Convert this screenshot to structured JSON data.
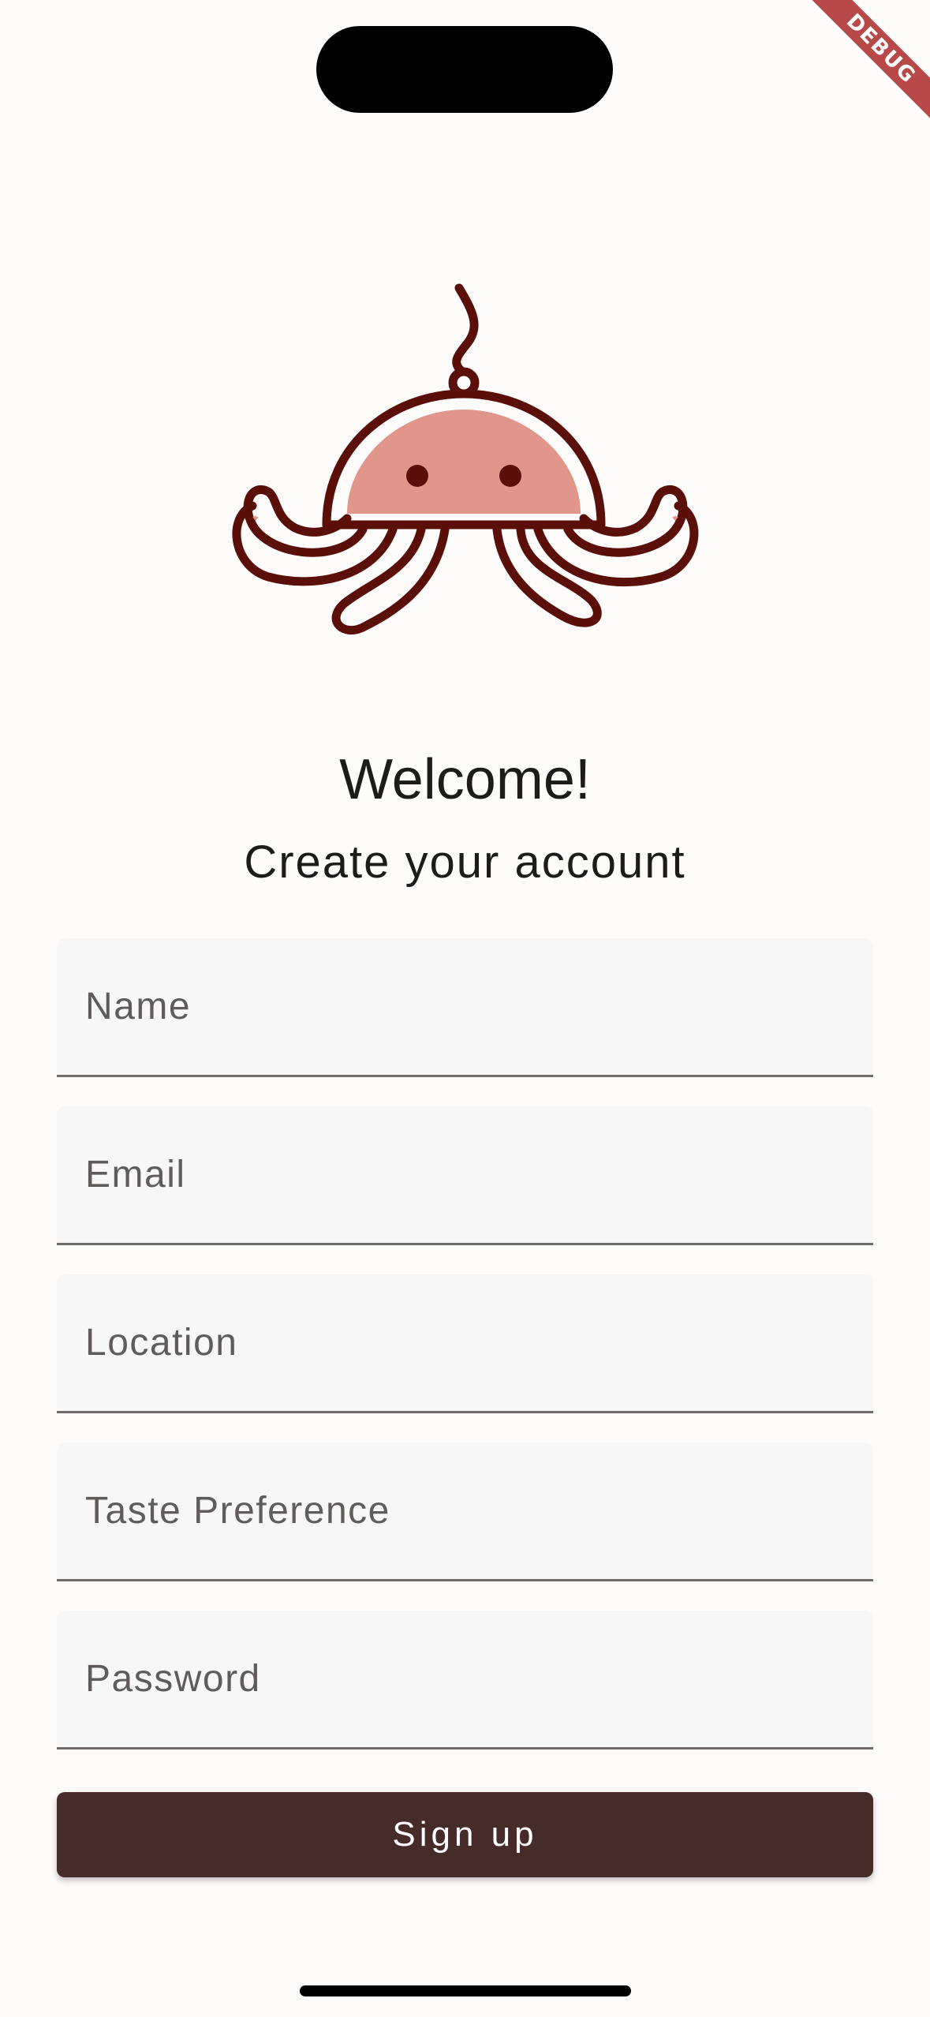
{
  "debug_banner": "DEBUG",
  "header": {
    "logo_icon": "jellyfish-icon",
    "welcome": "Welcome!",
    "subtitle": "Create your account"
  },
  "form": {
    "fields": [
      {
        "placeholder": "Name",
        "value": ""
      },
      {
        "placeholder": "Email",
        "value": ""
      },
      {
        "placeholder": "Location",
        "value": ""
      },
      {
        "placeholder": "Taste Preference",
        "value": ""
      },
      {
        "placeholder": "Password",
        "value": ""
      }
    ],
    "submit_label": "Sign up"
  },
  "colors": {
    "background": "#fefbfb",
    "brand_dark": "#452c28",
    "logo_stroke": "#5a0f08",
    "logo_fill": "#e0968a",
    "field_background": "#f7f7f7",
    "debug_ribbon": "#b23a3a"
  }
}
